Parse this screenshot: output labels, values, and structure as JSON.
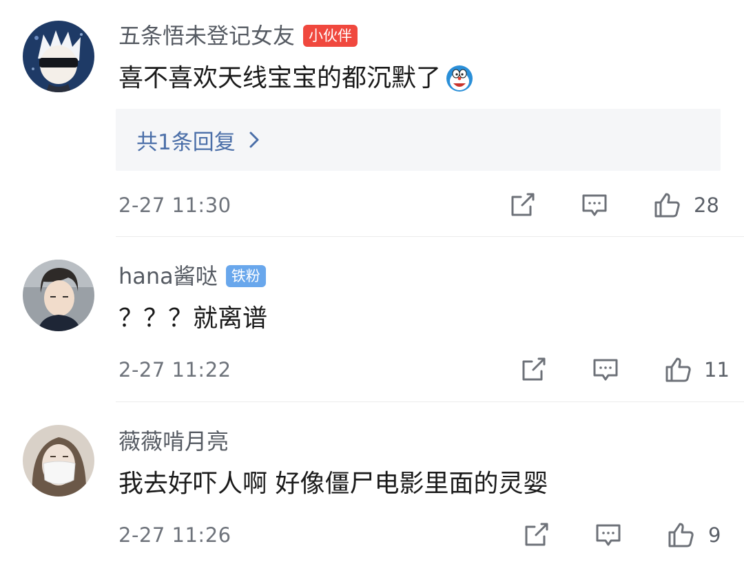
{
  "comments": [
    {
      "username": "五条悟未登记女友",
      "badge": "小伙伴",
      "badge_color": "#f0483e",
      "text": "喜不喜欢天线宝宝的都沉默了",
      "emoji": "doraemon-emoji",
      "replies_label": "共1条回复",
      "time": "2-27 11:30",
      "likes": "28"
    },
    {
      "username": "hana酱哒",
      "badge": "铁粉",
      "badge_color": "#69a7ec",
      "text": "？？？就离谱",
      "time": "2-27 11:22",
      "likes": "11"
    },
    {
      "username": "薇薇啃月亮",
      "text": "我去好吓人啊 好像僵尸电影里面的灵婴",
      "time": "2-27 11:26",
      "likes": "9"
    }
  ],
  "icons": {
    "repost": "share-icon",
    "reply": "comment-icon",
    "like": "thumbs-up-icon"
  }
}
